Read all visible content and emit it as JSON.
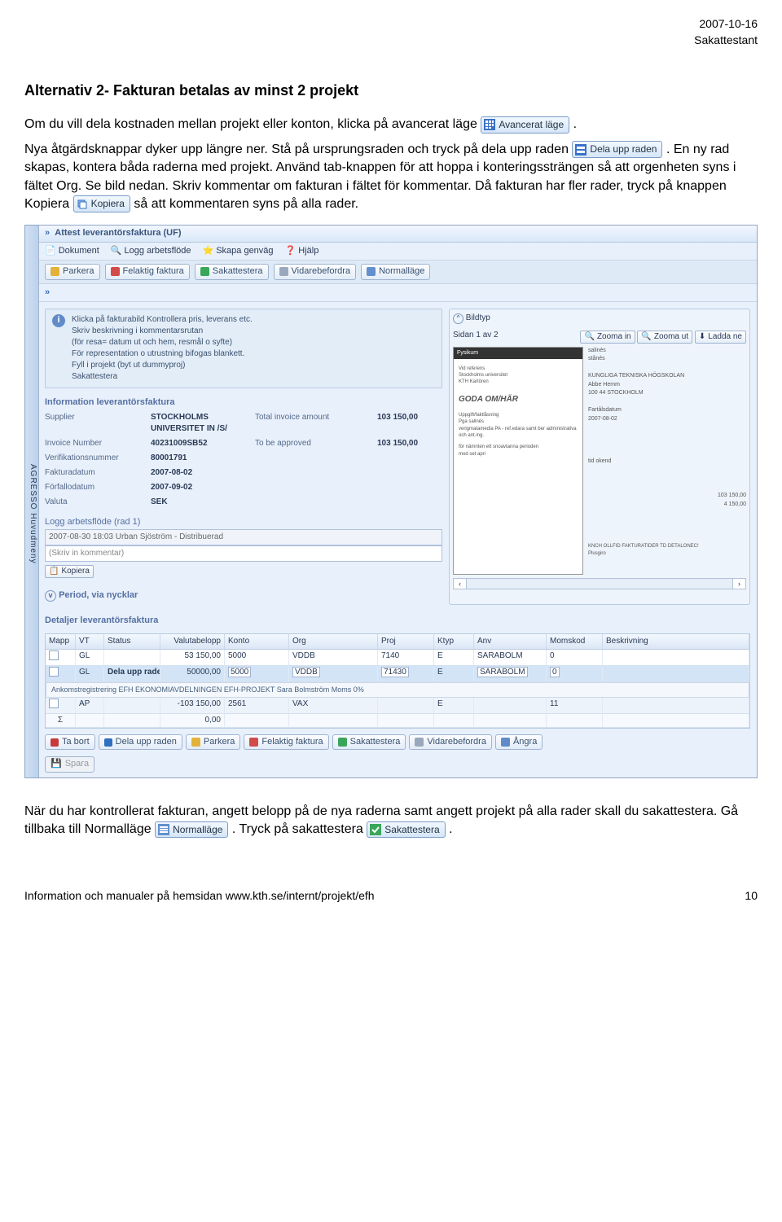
{
  "doc": {
    "date": "2007-10-16",
    "role": "Sakattestant",
    "heading": "Alternativ 2- Fakturan betalas av minst 2 projekt",
    "p1": "Om du vill dela kostnaden mellan projekt eller konton, klicka på avancerat läge ",
    "btn_avancerat": "Avancerat läge",
    "p1b": ".",
    "p2a": "Nya åtgärdsknappar dyker upp längre ner. Stå på ursprungsraden och tryck på dela upp raden ",
    "btn_delaupp": "Dela upp raden",
    "p2b": ". En ny rad skapas, kontera båda raderna med projekt. Använd tab-knappen för att hoppa i konteringssträngen så att orgenheten syns i fältet Org. Se bild nedan. Skriv kommentar om fakturan i fältet för kommentar. Då fakturan har fler rader, tryck på knappen Kopiera ",
    "btn_kopiera": "Kopiera",
    "p2c": " så att kommentaren syns på alla rader.",
    "p3a": "När du har kontrollerat fakturan, angett belopp på de nya raderna samt angett projekt på alla rader skall du sakattestera. Gå tillbaka till Normalläge ",
    "btn_normal": "Normalläge",
    "p3b": ". Tryck på sakattestera ",
    "btn_sak": "Sakattestera",
    "p3c": ".",
    "footer_left": "Information och manualer på hemsidan www.kth.se/internt/projekt/efh",
    "footer_right": "10"
  },
  "app": {
    "expand": "»",
    "title": "Attest leverantörsfaktura (UF)",
    "sidebar": "AGRESSO Huvudmeny",
    "menu": {
      "dokument": "Dokument",
      "logg": "Logg arbetsflöde",
      "skapa": "Skapa genväg",
      "hjalp": "Hjälp"
    },
    "toolbar": {
      "parkera": "Parkera",
      "felaktig": "Felaktig faktura",
      "sak": "Sakattestera",
      "vidare": "Vidarebefordra",
      "normal": "Normalläge"
    },
    "info": [
      "Klicka på fakturabild Kontrollera pris, leverans etc.",
      "Skriv beskrivning i kommentarsrutan",
      "(för resa= datum ut och hem, resmål o syfte)",
      "För representation o utrustning bifogas blankett.",
      "Fyll i projekt (byt ut dummyproj)",
      "Sakattestera"
    ],
    "sect1": "Information leverantörsfaktura",
    "fields": {
      "supplier_l": "Supplier",
      "supplier_v": "STOCKHOLMS UNIVERSITET IN /S/",
      "total_l": "Total invoice amount",
      "total_v": "103 150,00",
      "inv_l": "Invoice Number",
      "inv_v": "40231009SB52",
      "appr_l": "To be approved",
      "appr_v": "103 150,00",
      "ver_l": "Verifikationsnummer",
      "ver_v": "80001791",
      "fdat_l": "Fakturadatum",
      "fdat_v": "2007-08-02",
      "ffdat_l": "Förfallodatum",
      "ffdat_v": "2007-09-02",
      "val_l": "Valuta",
      "val_v": "SEK"
    },
    "log": {
      "title": "Logg arbetsflöde (rad 1)",
      "last": "2007-08-30 18:03 Urban Sjöström - Distribuerad",
      "ph": "(Skriv in kommentar)",
      "kopiera": "Kopiera"
    },
    "period": "Period, via nycklar",
    "detaljer": "Detaljer leverantörsfaktura",
    "bildtyp": "Bildtyp",
    "pager": {
      "page": "Sidan 1 av 2",
      "zin": "Zooma in",
      "zout": "Zooma ut",
      "ladda": "Ladda ne"
    },
    "invoice": {
      "brand": "Fysikum",
      "goda": "GODA OM/HÄR"
    },
    "cols": {
      "mapp": "Mapp",
      "vt": "VT",
      "status": "Status",
      "val": "Valutabelopp",
      "konto": "Konto",
      "org": "Org",
      "proj": "Proj",
      "ktyp": "Ktyp",
      "anv": "Anv",
      "moms": "Momskod",
      "besk": "Beskrivning"
    },
    "rows": [
      {
        "vt": "GL",
        "status": "",
        "val": "53 150,00",
        "konto": "5000",
        "org": "VDDB",
        "proj": "7140",
        "ktyp": "E",
        "anv": "SARABOLM",
        "moms": "0",
        "besk": ""
      },
      {
        "vt": "GL",
        "status": "Dela upp raden",
        "val": "50000,00",
        "konto": "5000",
        "org": "VDDB",
        "proj": "71430",
        "ktyp": "E",
        "anv": "SARABOLM",
        "moms": "0",
        "besk": ""
      },
      {
        "vt": "AP",
        "status": "",
        "val": "-103 150,00",
        "konto": "2561",
        "org": "VAX",
        "proj": "",
        "ktyp": "E",
        "anv": "",
        "moms": "11",
        "besk": ""
      },
      {
        "vt": "Σ",
        "status": "",
        "val": "0,00",
        "konto": "",
        "org": "",
        "proj": "",
        "ktyp": "",
        "anv": "",
        "moms": "",
        "besk": ""
      }
    ],
    "footbar": "Ankomstregistrering EFH   EKONOMIAVDELNINGEN   EFH-PROJEKT   Sara Bolmström  Moms 0%",
    "rowbtns": {
      "tabort": "Ta bort",
      "dela": "Dela upp raden",
      "parkera": "Parkera",
      "fel": "Felaktig faktura",
      "sak": "Sakattestera",
      "vidare": "Vidarebefordra",
      "angra": "Ångra"
    },
    "spara": "Spara"
  }
}
